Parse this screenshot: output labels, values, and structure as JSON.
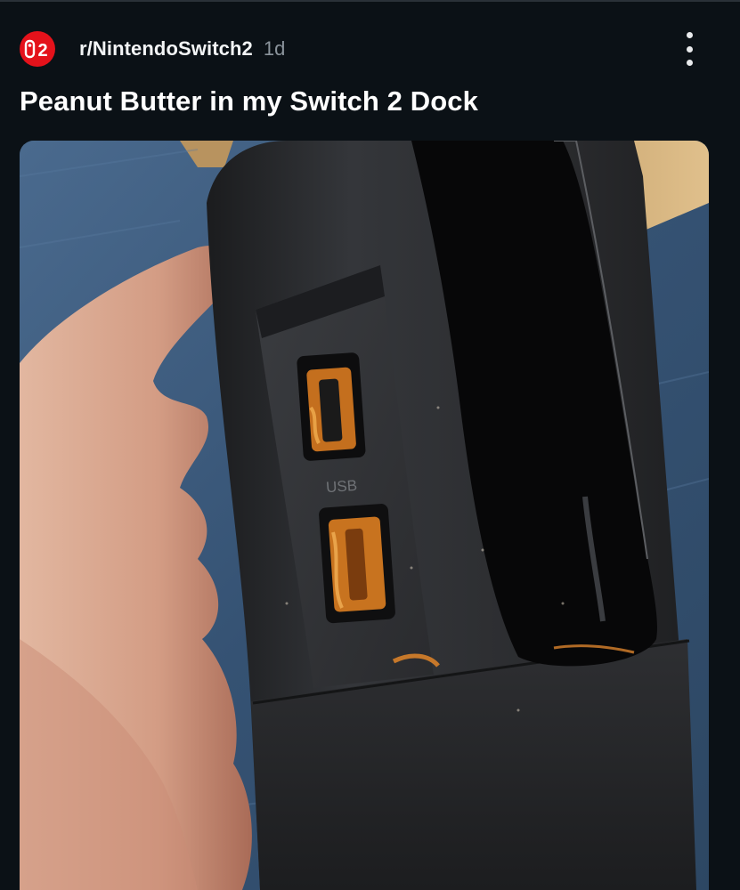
{
  "post": {
    "subreddit": "r/NintendoSwitch2",
    "age": "1d",
    "title": "Peanut Butter in my Switch 2 Dock",
    "avatar_icon": "nintendo-switch-2-logo-icon",
    "avatar_text": "2",
    "overflow_icon": "more-vertical-icon",
    "media": {
      "port_label": "USB"
    }
  },
  "colors": {
    "background": "#0b1116",
    "accent": "#e4121b",
    "muted_text": "#8b949c"
  }
}
